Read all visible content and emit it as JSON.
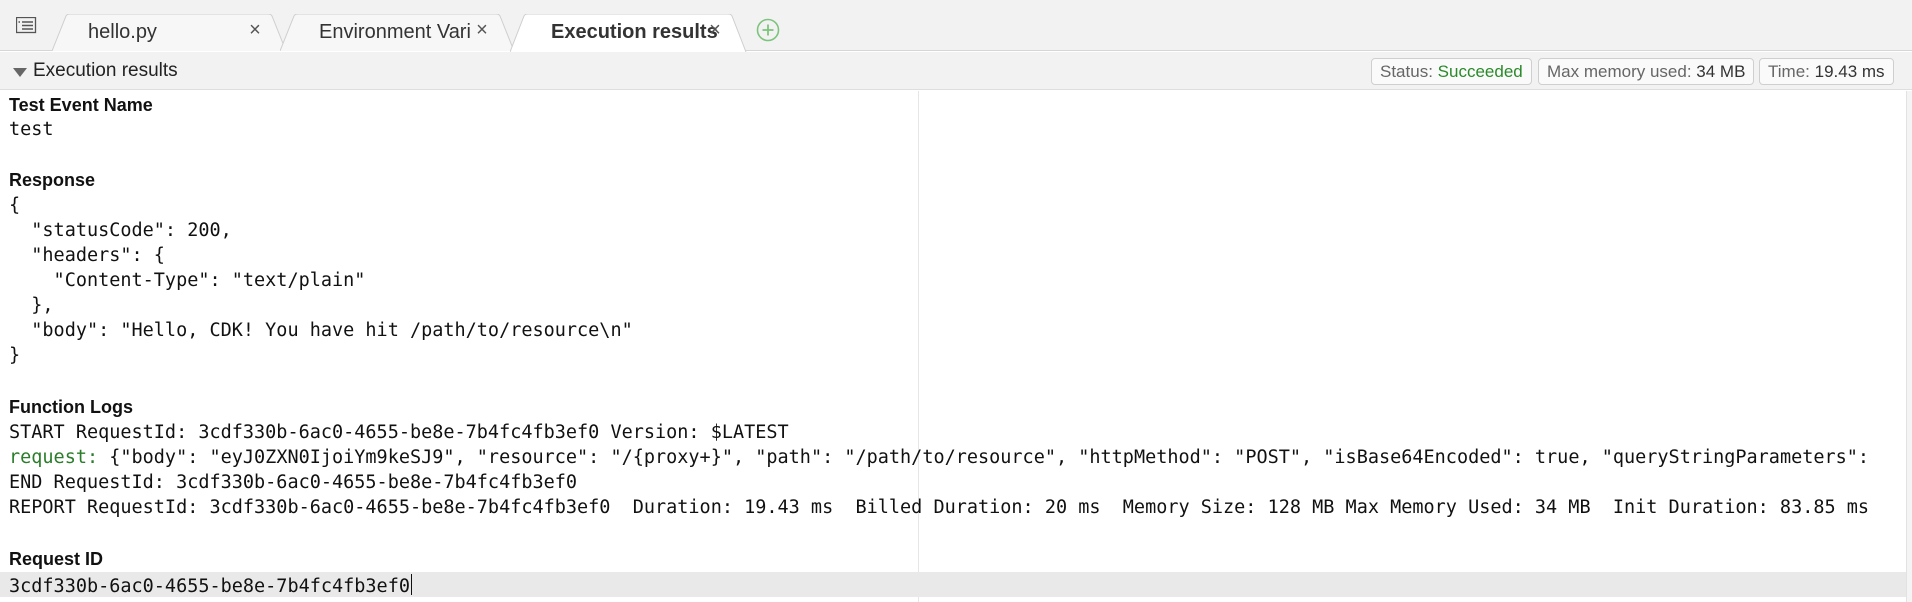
{
  "tabs": [
    {
      "label": "hello.py",
      "close": "×"
    },
    {
      "label": "Environment Vari",
      "close": "×"
    },
    {
      "label": "Execution results",
      "close": "×"
    }
  ],
  "panel": {
    "title": "Execution results",
    "status_label": "Status:",
    "status_value": "Succeeded",
    "memory_label": "Max memory used:",
    "memory_value": "34 MB",
    "time_label": "Time:",
    "time_value": "19.43 ms"
  },
  "test_event": {
    "heading": "Test Event Name",
    "value": "test"
  },
  "response": {
    "heading": "Response",
    "lines": [
      "{",
      "  \"statusCode\": 200,",
      "  \"headers\": {",
      "    \"Content-Type\": \"text/plain\"",
      "  },",
      "  \"body\": \"Hello, CDK! You have hit /path/to/resource\\n\"",
      "}"
    ]
  },
  "function_logs": {
    "heading": "Function Logs",
    "start_line": "START RequestId: 3cdf330b-6ac0-4655-be8e-7b4fc4fb3ef0 Version: $LATEST",
    "request_key": "request:",
    "request_value": " {\"body\": \"eyJ0ZXN0IjoiYm9keSJ9\", \"resource\": \"/{proxy+}\", \"path\": \"/path/to/resource\", \"httpMethod\": \"POST\", \"isBase64Encoded\": true, \"queryStringParameters\":",
    "end_line": "END RequestId: 3cdf330b-6ac0-4655-be8e-7b4fc4fb3ef0",
    "report_line": "REPORT RequestId: 3cdf330b-6ac0-4655-be8e-7b4fc4fb3ef0  Duration: 19.43 ms  Billed Duration: 20 ms  Memory Size: 128 MB Max Memory Used: 34 MB  Init Duration: 83.85 ms"
  },
  "request_id": {
    "heading": "Request ID",
    "value": "3cdf330b-6ac0-4655-be8e-7b4fc4fb3ef0"
  },
  "colors": {
    "success": "#2a8a2a",
    "log_key": "#2a7d2a",
    "add_tab": "#7cc47c"
  },
  "icons": {
    "menu": "list-menu-icon",
    "add_tab": "plus-circle-icon",
    "collapse": "triangle-down-icon",
    "close": "close-icon"
  }
}
